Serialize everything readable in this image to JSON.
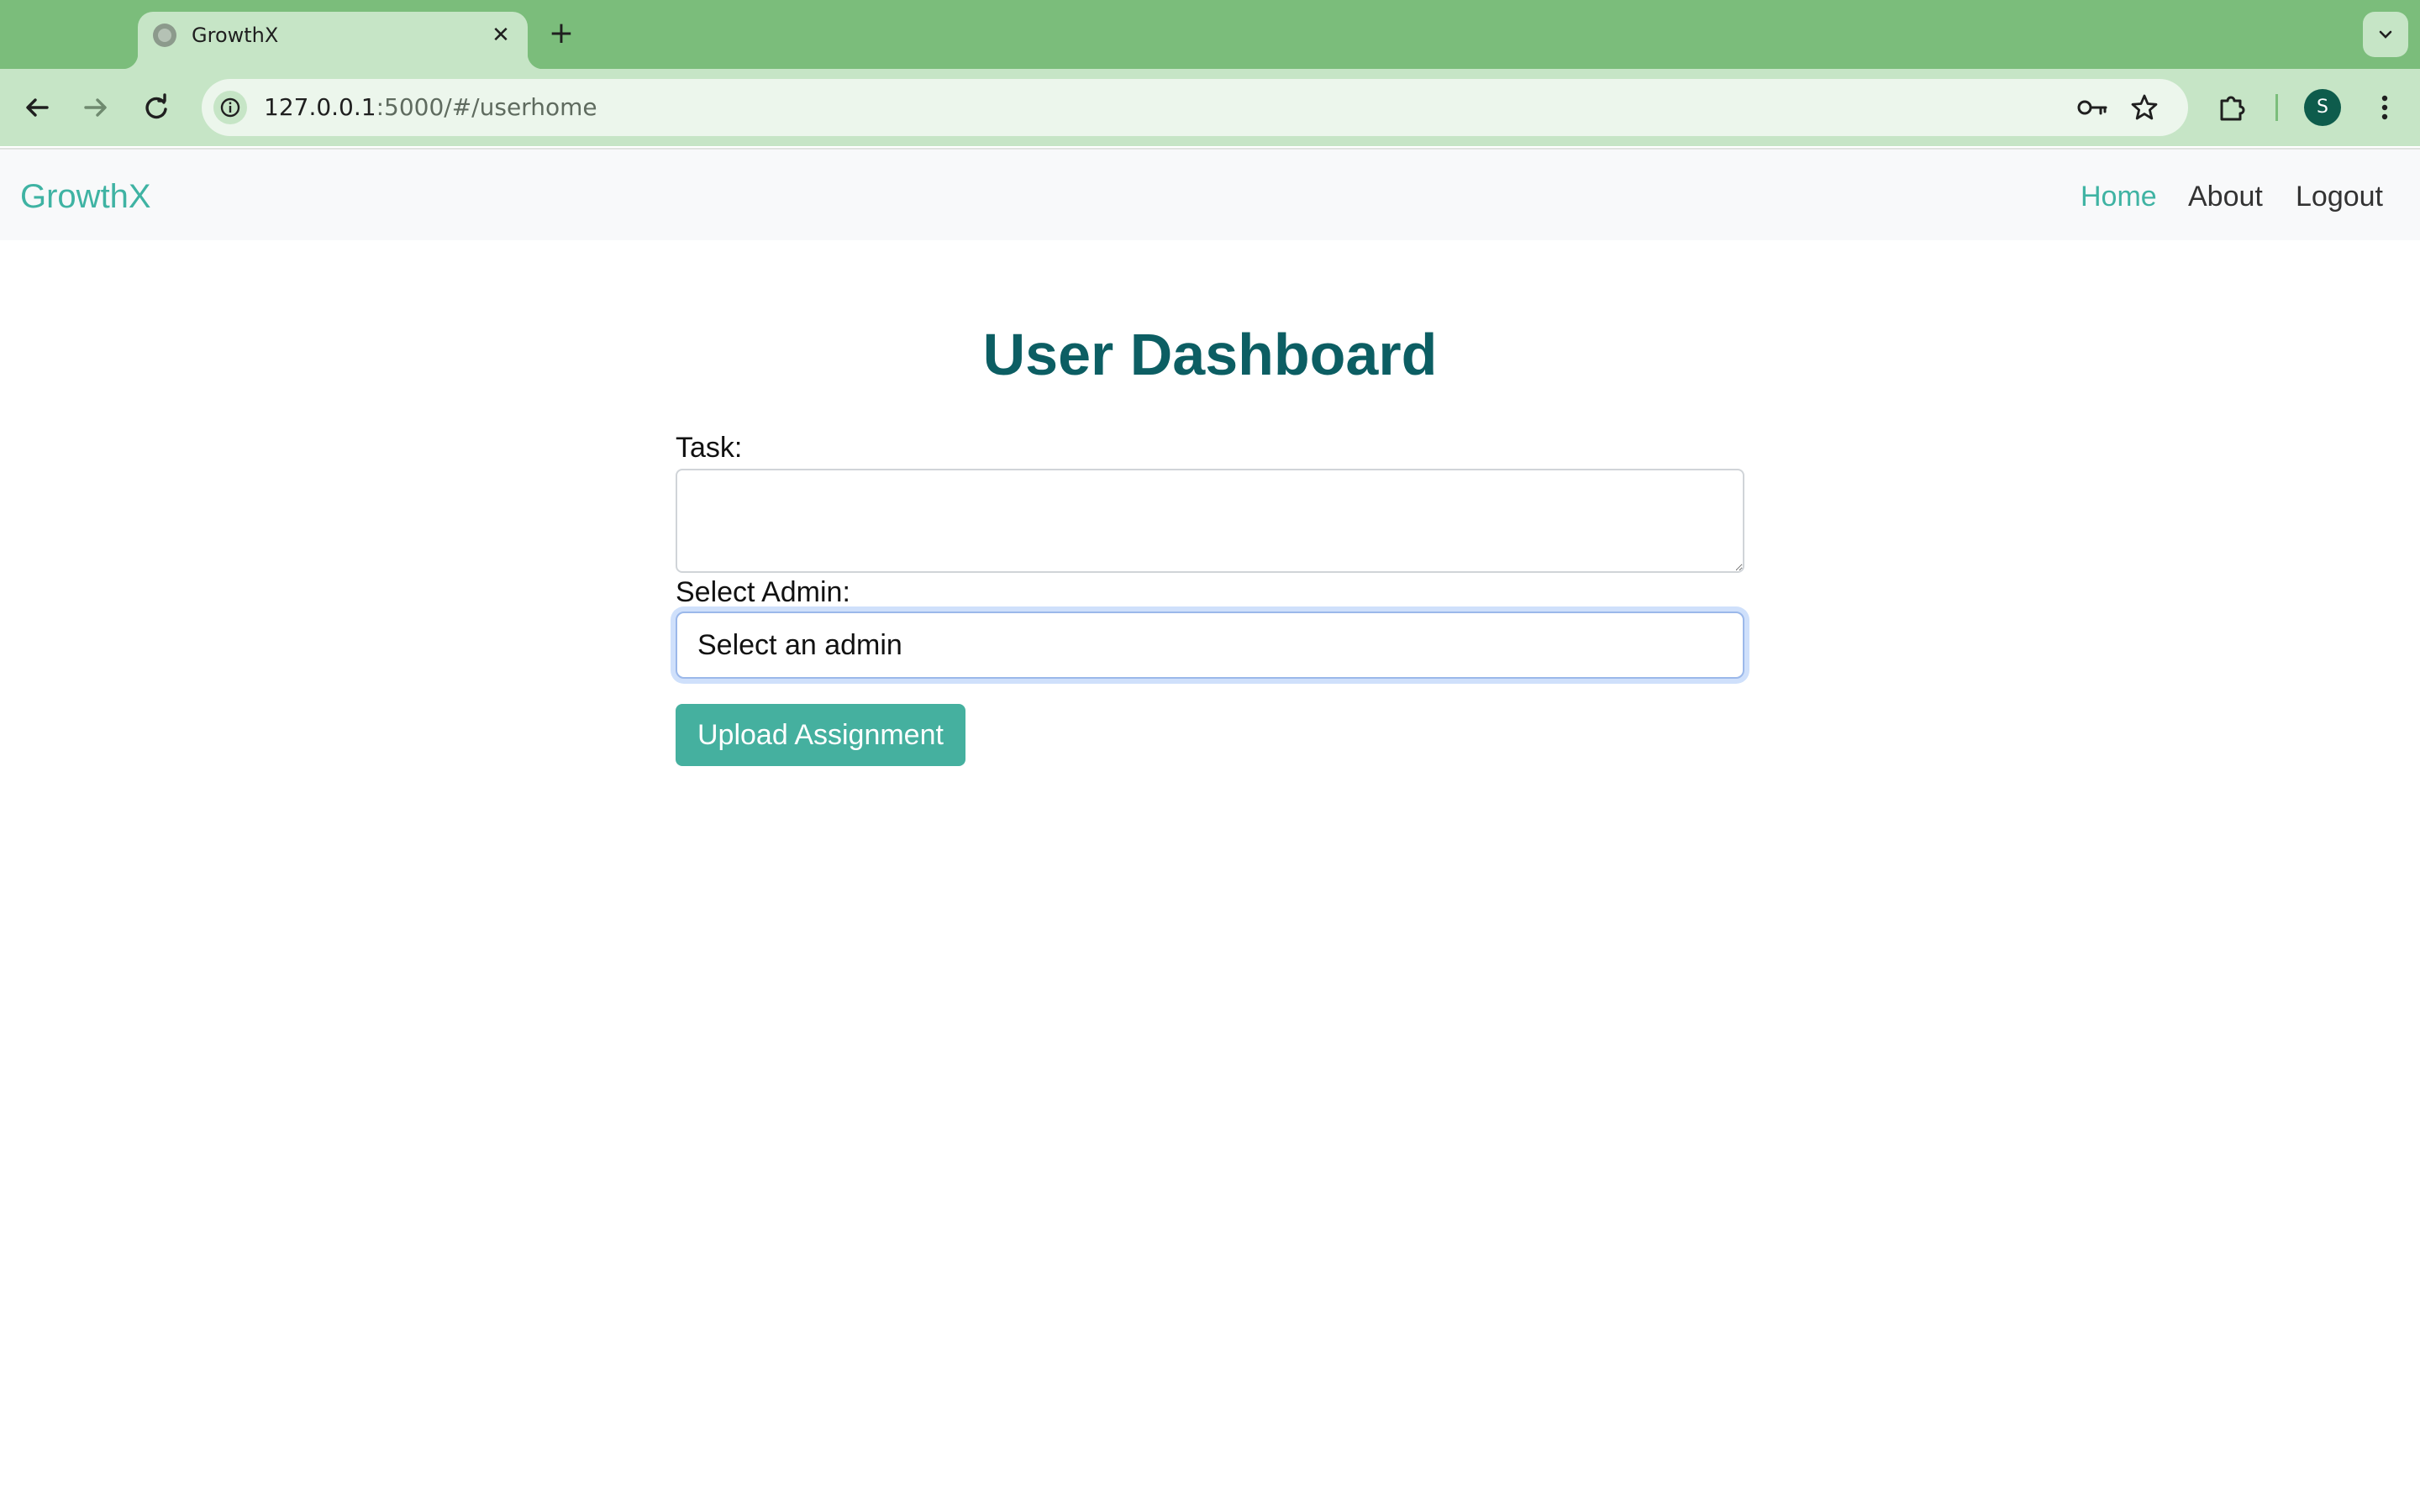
{
  "browser": {
    "tab_title": "GrowthX",
    "url_host": "127.0.0.1",
    "url_rest": ":5000/#/userhome",
    "profile_initial": "S"
  },
  "navbar": {
    "brand": "GrowthX",
    "links": [
      {
        "label": "Home",
        "active": true
      },
      {
        "label": "About",
        "active": false
      },
      {
        "label": "Logout",
        "active": false
      }
    ]
  },
  "main": {
    "title": "User Dashboard",
    "task_label": "Task:",
    "task_value": "",
    "admin_label": "Select Admin:",
    "admin_selected": "Select an admin",
    "submit_label": "Upload Assignment"
  },
  "colors": {
    "brand": "#3fb3a3",
    "heading": "#0c5e63",
    "button": "#45b09f",
    "chrome": "#7bbd7b"
  }
}
